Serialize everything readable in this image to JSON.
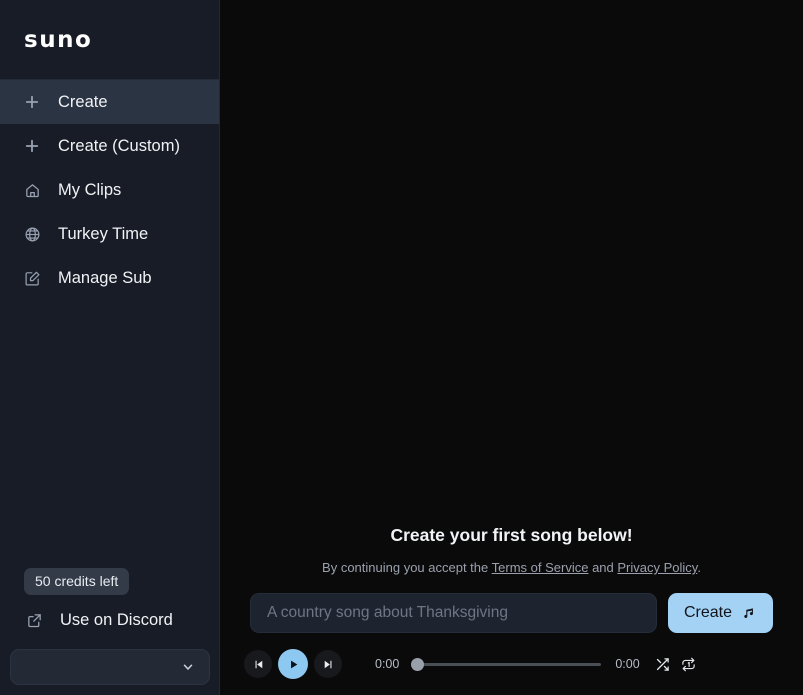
{
  "sidebar": {
    "logo": "suno",
    "items": [
      {
        "label": "Create",
        "icon": "plus-icon",
        "active": true
      },
      {
        "label": "Create (Custom)",
        "icon": "plus-icon",
        "active": false
      },
      {
        "label": "My Clips",
        "icon": "home-icon",
        "active": false
      },
      {
        "label": "Turkey Time",
        "icon": "globe-icon",
        "active": false
      },
      {
        "label": "Manage Sub",
        "icon": "edit-square-icon",
        "active": false
      }
    ],
    "credits_badge": "50 credits left",
    "discord": {
      "label": "Use on Discord",
      "icon": "external-link-icon"
    },
    "account_select": {
      "value": "",
      "icon": "chevron-down-icon"
    }
  },
  "main": {
    "hero_title": "Create your first song below!",
    "legal": {
      "prefix": "By continuing you accept the ",
      "terms_label": "Terms of Service",
      "middle": " and ",
      "privacy_label": "Privacy Policy",
      "suffix": "."
    },
    "prompt": {
      "value": "",
      "placeholder": "A country song about Thanksgiving"
    },
    "create_button": {
      "label": "Create",
      "icon": "music-note-icon"
    }
  },
  "player": {
    "prev_icon": "skip-previous-icon",
    "play_icon": "play-icon",
    "next_icon": "skip-next-icon",
    "current_time": "0:00",
    "total_time": "0:00",
    "progress_percent": 0,
    "shuffle_icon": "shuffle-icon",
    "repeat_icon": "repeat-one-icon"
  },
  "colors": {
    "sidebar_bg": "#181c26",
    "sidebar_active": "#2b3442",
    "main_bg": "#0a0a0b",
    "accent": "#a3d2f5",
    "play_accent": "#8dc8f0",
    "input_bg": "#1d242f",
    "badge_bg": "#333b49",
    "text_primary": "#f0f2f5",
    "text_muted": "#9aa1ad"
  }
}
